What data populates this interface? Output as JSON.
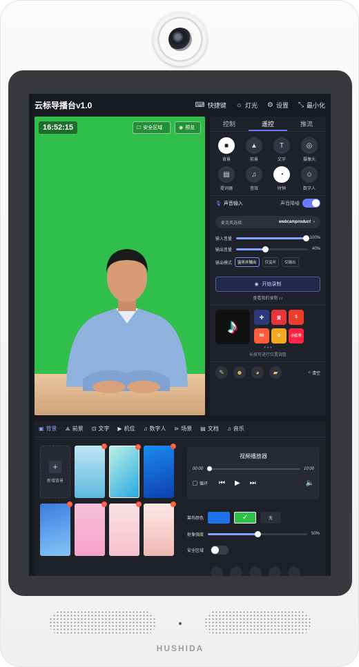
{
  "device": {
    "brand": "HUSHIDA"
  },
  "titlebar": {
    "title": "云标导播台v1.0",
    "actions": [
      {
        "icon": "keyboard-icon",
        "label": "快捷键"
      },
      {
        "icon": "sun-icon",
        "label": "灯光"
      },
      {
        "icon": "gear-icon",
        "label": "设置"
      },
      {
        "icon": "minimize-icon",
        "label": "最小化"
      }
    ]
  },
  "preview": {
    "clock": "16:52:15",
    "safe_area_label": "安全区域",
    "preview_label": "预览"
  },
  "right_panel": {
    "tabs": [
      {
        "label": "控制",
        "active": false
      },
      {
        "label": "遥控",
        "active": true
      },
      {
        "label": "推流",
        "active": false
      }
    ],
    "grid": [
      {
        "icon": "background-icon",
        "label": "背景",
        "active": true
      },
      {
        "icon": "foreground-icon",
        "label": "前景",
        "active": false
      },
      {
        "icon": "text-icon",
        "label": "文字",
        "active": false
      },
      {
        "icon": "camera-icon",
        "label": "摄像头",
        "active": false
      },
      {
        "icon": "teleprompter-icon",
        "label": "提词器",
        "active": false
      },
      {
        "icon": "audio-icon",
        "label": "音效",
        "active": false
      },
      {
        "icon": "clock-icon",
        "label": "时钟",
        "active": true
      },
      {
        "icon": "digital-human-icon",
        "label": "数字人",
        "active": false
      }
    ],
    "sound_input_label": "声音输入",
    "noise_reduction_label": "声音降噪",
    "noise_reduction_on": true,
    "mic_select_label": "麦克风选择:",
    "mic_select_value": "webcamproduct",
    "input_volume_label": "输入音量",
    "input_volume_value": "100%",
    "input_volume_level": 1.0,
    "output_volume_label": "输出音量",
    "output_volume_value": "40%",
    "output_volume_level": 0.4,
    "output_mode_label": "输出模式",
    "output_modes": [
      {
        "label": "监听并输出",
        "active": true
      },
      {
        "label": "仅监听",
        "active": false
      },
      {
        "label": "仅输出",
        "active": false
      }
    ],
    "record_button_label": "开始录制",
    "record_note": "查看我的录制",
    "apps": [
      {
        "name": "抖音",
        "color": "#111111"
      },
      {
        "name": "+",
        "color": "#2b3a7a"
      },
      {
        "name": "爱",
        "color": "#e8333d"
      },
      {
        "name": "5",
        "color": "#ee3d2d"
      },
      {
        "name": "88",
        "color": "#ff5c37"
      },
      {
        "name": "✿",
        "color": "#f6a821"
      },
      {
        "name": "小红书",
        "color": "#ff2442"
      }
    ],
    "app_hint": "长按可进行位置调整",
    "clear_label": "清空"
  },
  "bottom": {
    "tabs": [
      {
        "icon": "background-icon",
        "label": "背景",
        "active": true
      },
      {
        "icon": "foreground-icon",
        "label": "前景",
        "active": false
      },
      {
        "icon": "text-icon",
        "label": "文字",
        "active": false
      },
      {
        "icon": "camera-icon",
        "label": "机位",
        "active": false
      },
      {
        "icon": "music-icon",
        "label": "数字人",
        "active": false
      },
      {
        "icon": "scene-icon",
        "label": "场景",
        "active": false
      },
      {
        "icon": "document-icon",
        "label": "文档",
        "active": false
      },
      {
        "icon": "music-icon",
        "label": "音乐",
        "active": false
      }
    ],
    "new_background_label": "新增背景",
    "thumbs": [
      {
        "kind": "new"
      },
      {
        "colors": [
          "#bfe6f3",
          "#5fb8e0"
        ]
      },
      {
        "colors": [
          "#b8f0e6",
          "#2aa8e0"
        ]
      },
      {
        "colors": [
          "#1d8cf0",
          "#0b3fb0"
        ]
      },
      {
        "colors": [
          "#3a7be0",
          "#86c6f7"
        ]
      },
      {
        "colors": [
          "#f7c1d9",
          "#f6a3c8"
        ]
      },
      {
        "colors": [
          "#fbe2e8",
          "#f4c0cc"
        ]
      },
      {
        "colors": [
          "#fde8e6",
          "#f0b8b3"
        ]
      }
    ],
    "player": {
      "title": "视频播放器",
      "start": "00:00",
      "end": "10:00",
      "loop_label": "循环"
    },
    "screen_color_label": "幕布颜色",
    "screen_colors": [
      "#1e73e8",
      "#2fbf4a"
    ],
    "screen_color_none": "无",
    "matte_label": "抠像强度",
    "matte_value": "50%",
    "matte_level": 0.5,
    "safe_area_label": "安全区域"
  }
}
